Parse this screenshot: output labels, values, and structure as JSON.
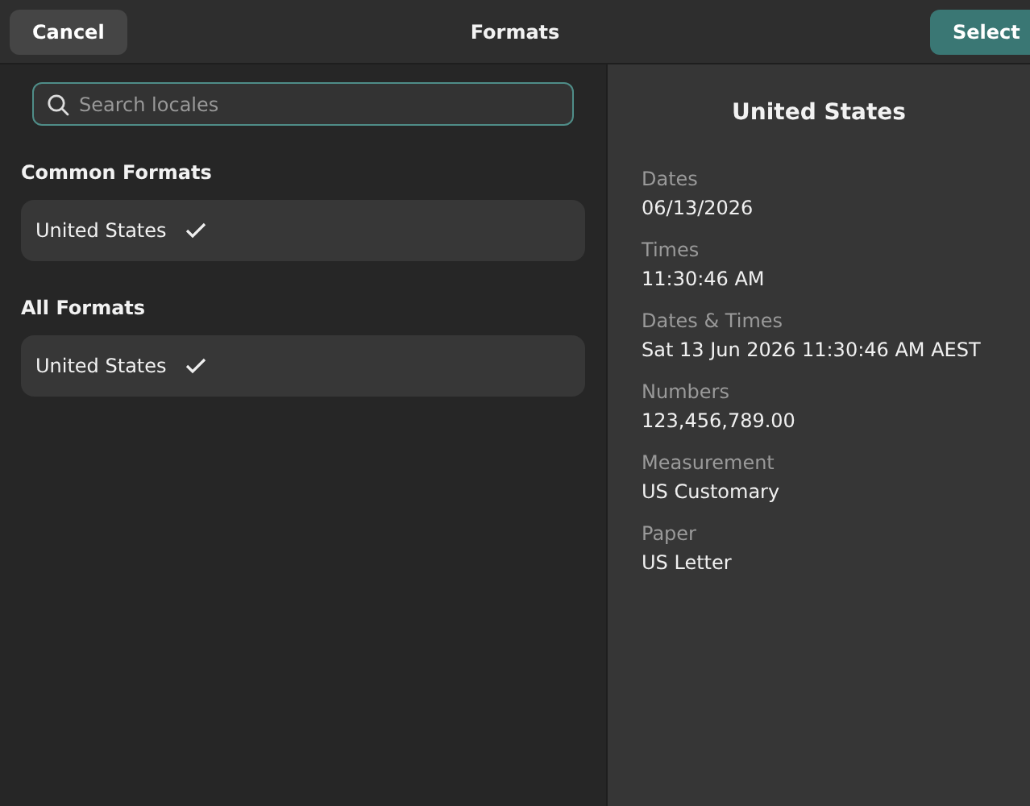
{
  "header": {
    "cancel": "Cancel",
    "title": "Formats",
    "select": "Select"
  },
  "search": {
    "placeholder": "Search locales"
  },
  "sections": [
    {
      "title": "Common Formats",
      "items": [
        {
          "label": "United States",
          "checked": true
        }
      ]
    },
    {
      "title": "All Formats",
      "items": [
        {
          "label": "United States",
          "checked": true
        }
      ]
    }
  ],
  "preview": {
    "title": "United States",
    "fields": [
      {
        "label": "Dates",
        "value": "06/13/2026"
      },
      {
        "label": "Times",
        "value": "11:30:46 AM"
      },
      {
        "label": "Dates & Times",
        "value": "Sat 13 Jun 2026 11:30:46 AM AEST"
      },
      {
        "label": "Numbers",
        "value": "123,456,789.00"
      },
      {
        "label": "Measurement",
        "value": "US Customary"
      },
      {
        "label": "Paper",
        "value": "US Letter"
      }
    ]
  }
}
